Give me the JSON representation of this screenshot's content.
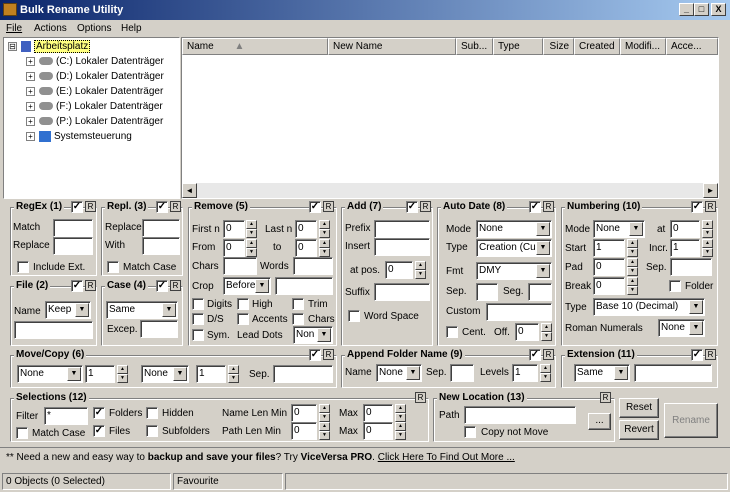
{
  "window": {
    "title": "Bulk Rename Utility",
    "min": "_",
    "max": "□",
    "close": "X"
  },
  "menu": [
    "File",
    "Actions",
    "Options",
    "Help"
  ],
  "tree": [
    {
      "label": "Arbeitsplatz",
      "pm": "⊟"
    },
    {
      "label": "(C:) Lokaler Datenträger",
      "pm": "+"
    },
    {
      "label": "(D:) Lokaler Datenträger",
      "pm": "+"
    },
    {
      "label": "(E:) Lokaler Datenträger",
      "pm": "+"
    },
    {
      "label": "(F:) Lokaler Datenträger",
      "pm": "+"
    },
    {
      "label": "(P:) Lokaler Datenträger",
      "pm": "+"
    },
    {
      "label": "Systemsteuerung",
      "pm": "+"
    }
  ],
  "columns": [
    "Name",
    "New Name",
    "Sub...",
    "Type",
    "Size",
    "Created",
    "Modifi...",
    "Acce..."
  ],
  "regex": {
    "title": "RegEx (1)",
    "r": "R",
    "match": "Match",
    "replace": "Replace",
    "include": "Include Ext."
  },
  "repl": {
    "title": "Repl. (3)",
    "r": "R",
    "replace": "Replace",
    "with": "With",
    "matchcase": "Match Case"
  },
  "remove": {
    "title": "Remove (5)",
    "r": "R",
    "firstn": "First n",
    "firstn_v": "0",
    "lastn": "Last n",
    "lastn_v": "0",
    "from": "From",
    "from_v": "0",
    "to": "to",
    "to_v": "0",
    "chars": "Chars",
    "words": "Words",
    "crop": "Crop",
    "crop_v": "Before",
    "digits": "Digits",
    "high": "High",
    "trim": "Trim",
    "ds": "D/S",
    "accents": "Accents",
    "chars2": "Chars",
    "sym": "Sym.",
    "leaddots": "Lead Dots",
    "leaddots_v": "Non"
  },
  "add": {
    "title": "Add (7)",
    "r": "R",
    "prefix": "Prefix",
    "insert": "Insert",
    "atpos": "at pos.",
    "atpos_v": "0",
    "suffix": "Suffix",
    "wordspace": "Word Space"
  },
  "autodate": {
    "title": "Auto Date (8)",
    "r": "R",
    "mode": "Mode",
    "mode_v": "None",
    "type": "Type",
    "type_v": "Creation (Curr",
    "fmt": "Fmt",
    "fmt_v": "DMY",
    "sep": "Sep.",
    "seg": "Seg.",
    "custom": "Custom",
    "cent": "Cent.",
    "off": "Off.",
    "off_v": "0"
  },
  "numbering": {
    "title": "Numbering (10)",
    "r": "R",
    "mode": "Mode",
    "mode_v": "None",
    "at": "at",
    "at_v": "0",
    "start": "Start",
    "start_v": "1",
    "incr": "Incr.",
    "incr_v": "1",
    "pad": "Pad",
    "pad_v": "0",
    "sep": "Sep.",
    "brk": "Break",
    "brk_v": "0",
    "folder": "Folder",
    "type": "Type",
    "type_v": "Base 10 (Decimal)",
    "roman": "Roman Numerals",
    "roman_v": "None"
  },
  "file": {
    "title": "File (2)",
    "r": "R",
    "name": "Name",
    "name_v": "Keep"
  },
  "casebox": {
    "title": "Case (4)",
    "r": "R",
    "v": "Same",
    "excep": "Excep."
  },
  "movecopy": {
    "title": "Move/Copy (6)",
    "r": "R",
    "v1": "None",
    "n1": "1",
    "v2": "None",
    "n2": "1",
    "sep": "Sep."
  },
  "appendfolder": {
    "title": "Append Folder Name (9)",
    "r": "R",
    "name": "Name",
    "name_v": "None",
    "sep": "Sep.",
    "levels": "Levels",
    "levels_v": "1"
  },
  "extension": {
    "title": "Extension (11)",
    "r": "R",
    "v": "Same"
  },
  "selections": {
    "title": "Selections (12)",
    "r": "R",
    "filter": "Filter",
    "filter_v": "*",
    "folders": "Folders",
    "hidden": "Hidden",
    "nlmin": "Name Len Min",
    "nlmin_v": "0",
    "max": "Max",
    "max_v": "0",
    "matchcase": "Match Case",
    "files": "Files",
    "subfolders": "Subfolders",
    "plmin": "Path Len Min",
    "plmin_v": "0",
    "max2": "Max",
    "max2_v": "0"
  },
  "newloc": {
    "title": "New Location (13)",
    "r": "R",
    "path": "Path",
    "browse": "...",
    "copynot": "Copy not Move"
  },
  "buttons": {
    "reset": "Reset",
    "revert": "Revert",
    "rename": "Rename"
  },
  "ad": {
    "pre": "** Need a new and easy way to ",
    "bold": "backup and save your files",
    "mid": "? Try ",
    "brand": "ViceVersa PRO",
    "dot": ". ",
    "link": "Click Here To Find Out More ..."
  },
  "status": {
    "objects": "0 Objects (0 Selected)",
    "fav": "Favourite"
  }
}
